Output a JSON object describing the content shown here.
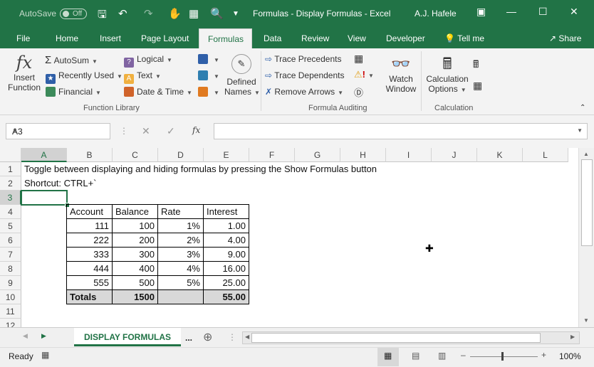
{
  "titlebar": {
    "autosave_label": "AutoSave",
    "autosave_state": "Off",
    "title": "Formulas - Display Formulas  -  Excel",
    "user": "A.J. Hafele"
  },
  "menu": {
    "file": "File",
    "home": "Home",
    "insert": "Insert",
    "page_layout": "Page Layout",
    "formulas": "Formulas",
    "data": "Data",
    "review": "Review",
    "view": "View",
    "developer": "Developer",
    "tell_me": "Tell me",
    "share": "Share"
  },
  "ribbon": {
    "insert_function_1": "Insert",
    "insert_function_2": "Function",
    "autosum": "AutoSum",
    "recently_used": "Recently Used",
    "financial": "Financial",
    "logical": "Logical",
    "text": "Text",
    "date_time": "Date & Time",
    "defined_names_1": "Defined",
    "defined_names_2": "Names",
    "function_library": "Function Library",
    "trace_precedents": "Trace Precedents",
    "trace_dependents": "Trace Dependents",
    "remove_arrows": "Remove Arrows",
    "watch_window_1": "Watch",
    "watch_window_2": "Window",
    "formula_auditing": "Formula Auditing",
    "calc_options_1": "Calculation",
    "calc_options_2": "Options",
    "calculation": "Calculation"
  },
  "formula_bar": {
    "name_box": "A3",
    "fx": "fx",
    "value": ""
  },
  "columns": [
    "A",
    "B",
    "C",
    "D",
    "E",
    "F",
    "G",
    "H",
    "I",
    "J",
    "K",
    "L"
  ],
  "rows": [
    "1",
    "2",
    "3",
    "4",
    "5",
    "6",
    "7",
    "8",
    "9",
    "10",
    "11",
    "12"
  ],
  "cells": {
    "a1": "Toggle between displaying and hiding formulas by pressing the Show Formulas button",
    "a2": "Shortcut: CTRL+`"
  },
  "table": {
    "headers": [
      "Account",
      "Balance",
      "Rate",
      "Interest"
    ],
    "rows": [
      [
        "111",
        "100",
        "1%",
        "1.00"
      ],
      [
        "222",
        "200",
        "2%",
        "4.00"
      ],
      [
        "333",
        "300",
        "3%",
        "9.00"
      ],
      [
        "444",
        "400",
        "4%",
        "16.00"
      ],
      [
        "555",
        "500",
        "5%",
        "25.00"
      ]
    ],
    "totals": [
      "Totals",
      "1500",
      "",
      "55.00"
    ]
  },
  "sheet_tabs": {
    "active": "DISPLAY FORMULAS",
    "more": "..."
  },
  "status": {
    "ready": "Ready",
    "zoom": "100%"
  },
  "colors": {
    "brand": "#217346"
  }
}
